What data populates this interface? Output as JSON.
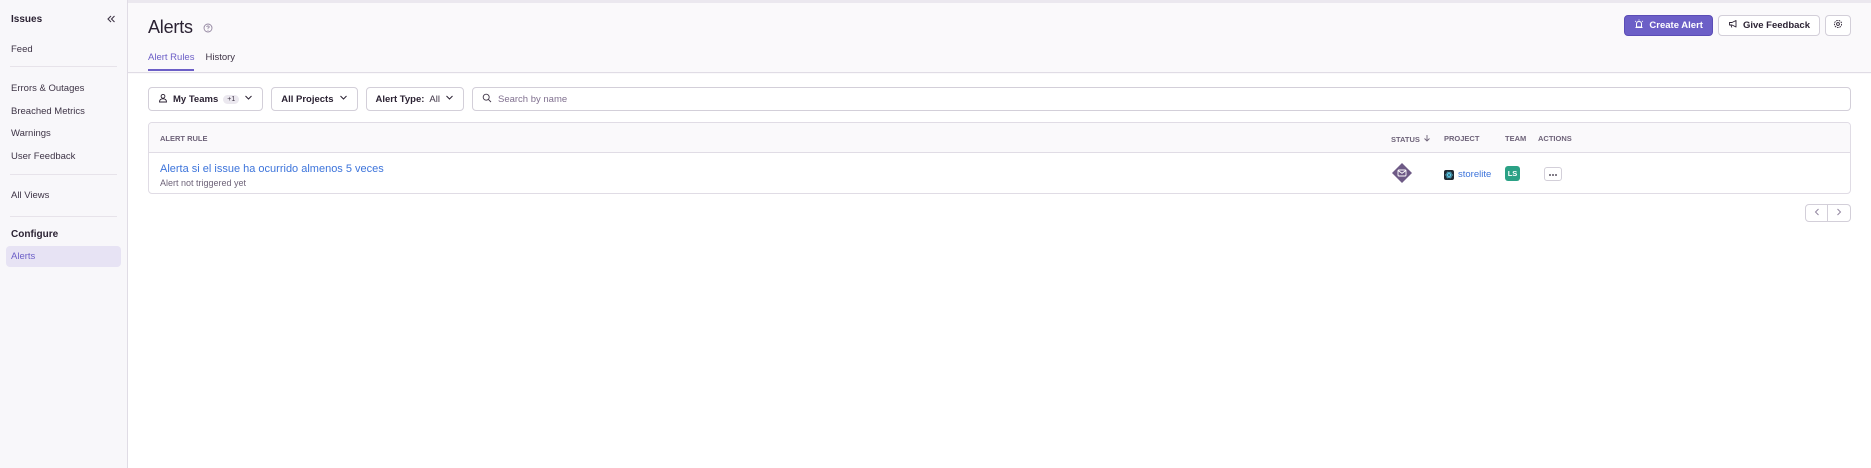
{
  "sidebar": {
    "title": "Issues",
    "items": [
      {
        "label": "Feed"
      },
      {
        "label": "Errors & Outages"
      },
      {
        "label": "Breached Metrics"
      },
      {
        "label": "Warnings"
      },
      {
        "label": "User Feedback"
      },
      {
        "label": "All Views"
      }
    ],
    "configure_section": "Configure",
    "configure_items": [
      {
        "label": "Alerts",
        "active": true
      }
    ]
  },
  "header": {
    "title": "Alerts",
    "tabs": [
      {
        "label": "Alert Rules",
        "active": true
      },
      {
        "label": "History"
      }
    ],
    "create_alert_label": "Create Alert",
    "give_feedback_label": "Give Feedback"
  },
  "filters": {
    "teams_label": "My Teams",
    "teams_count": "+1",
    "projects_label": "All Projects",
    "alert_type_label": "Alert Type:",
    "alert_type_value": "All",
    "search_placeholder": "Search by name"
  },
  "table": {
    "columns": {
      "alert_rule": "Alert Rule",
      "status": "Status",
      "project": "Project",
      "team": "Team",
      "actions": "Actions"
    },
    "rows": [
      {
        "name": "Alerta si el issue ha ocurrido almenos 5 veces",
        "subtitle": "Alert not triggered yet",
        "project": "storelite",
        "team_initials": "LS"
      }
    ]
  },
  "colors": {
    "accent": "#6c5fc7",
    "link": "#3d74db",
    "team_avatar": "#2ba185",
    "status_diamond": "#6e5a86"
  },
  "icons": [
    "collapse-sidebar-icon",
    "help-icon",
    "siren-icon",
    "megaphone-icon",
    "gear-icon",
    "user-icon",
    "chevron-down-icon",
    "search-icon",
    "sort-arrow-icon",
    "mail-icon",
    "react-icon",
    "ellipsis-icon",
    "chevron-left-icon",
    "chevron-right-icon"
  ]
}
